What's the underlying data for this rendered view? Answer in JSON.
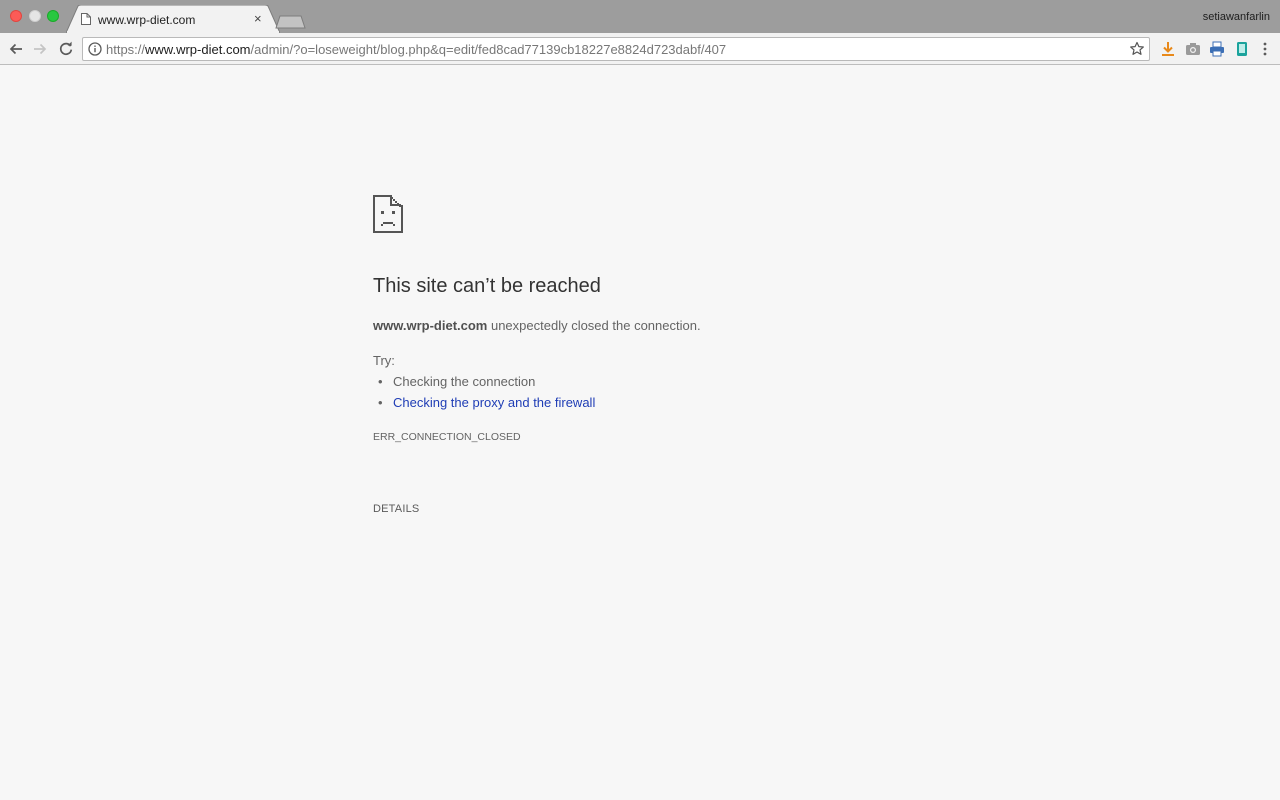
{
  "browser": {
    "tab": {
      "title": "www.wrp-diet.com",
      "close": "×"
    },
    "profile_name": "setiawanfarlin",
    "address": {
      "scheme": "https://",
      "host": "www.wrp-diet.com",
      "path": "/admin/?o=loseweight/blog.php&q=edit/fed8cad77139cb18227e8824d723dabf/407"
    },
    "icons": [
      "back-icon",
      "forward-icon",
      "reload-icon",
      "info-icon",
      "bookmark-star-icon",
      "download-icon",
      "camera-icon",
      "printer-icon",
      "tablet-icon",
      "menu-icon"
    ],
    "colors": {
      "tabstrip": "#9d9d9d",
      "toolbar": "#f2f2f2",
      "close": "#fc5b57",
      "zoom": "#28c840"
    }
  },
  "error": {
    "headline": "This site can’t be reached",
    "host": "www.wrp-diet.com",
    "message_rest": " unexpectedly closed the connection.",
    "try_label": "Try:",
    "suggestions": [
      "Checking the connection",
      "Checking the proxy and the firewall"
    ],
    "code": "ERR_CONNECTION_CLOSED",
    "details_label": "DETAILS",
    "colors": {
      "link": "#1f3db5",
      "text": "#646464",
      "headline": "#333333"
    }
  }
}
